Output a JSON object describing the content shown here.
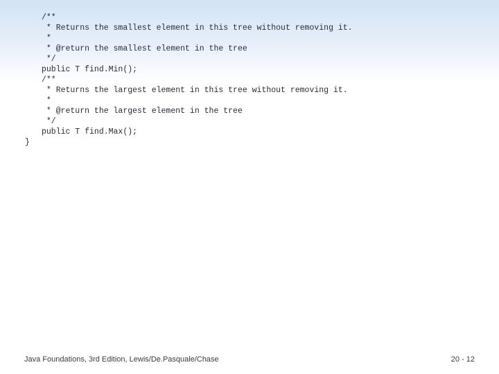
{
  "code": {
    "lines": [
      "/**",
      " * Returns the smallest element in this tree without removing it.",
      " *",
      " * @return the smallest element in the tree",
      " */",
      "public T find.Min();",
      "",
      "/**",
      " * Returns the largest element in this tree without removing it.",
      " *",
      " * @return the largest element in the tree",
      " */",
      "public T find.Max();"
    ],
    "closing": "}"
  },
  "footer": {
    "left": "Java Foundations, 3rd Edition, Lewis/De.Pasquale/Chase",
    "right": "20 - 12"
  }
}
